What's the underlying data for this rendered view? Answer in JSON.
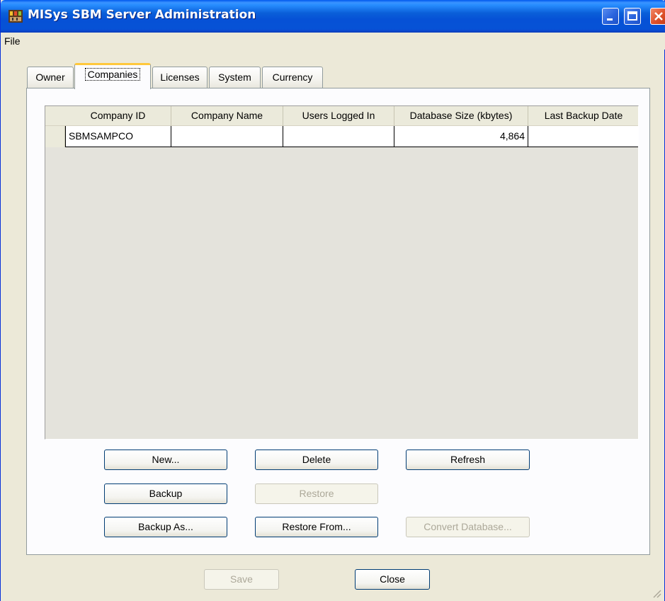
{
  "window": {
    "title": "MISys SBM Server Administration"
  },
  "menu": {
    "file": "File"
  },
  "tabs": [
    "Owner",
    "Companies",
    "Licenses",
    "System",
    "Currency"
  ],
  "active_tab": "Companies",
  "grid": {
    "headers": [
      "Company ID",
      "Company Name",
      "Users Logged In",
      "Database Size (kbytes)",
      "Last Backup Date"
    ],
    "rows": [
      {
        "company_id": "SBMSAMPCO",
        "company_name": "",
        "users_logged_in": "",
        "database_size": "4,864",
        "last_backup_date": ""
      }
    ]
  },
  "buttons": {
    "new": "New...",
    "delete": "Delete",
    "refresh": "Refresh",
    "backup": "Backup",
    "restore": "Restore",
    "backup_as": "Backup As...",
    "restore_from": "Restore From...",
    "convert_database": "Convert Database...",
    "save": "Save",
    "close": "Close"
  },
  "disabled": [
    "restore",
    "convert_database",
    "save"
  ]
}
